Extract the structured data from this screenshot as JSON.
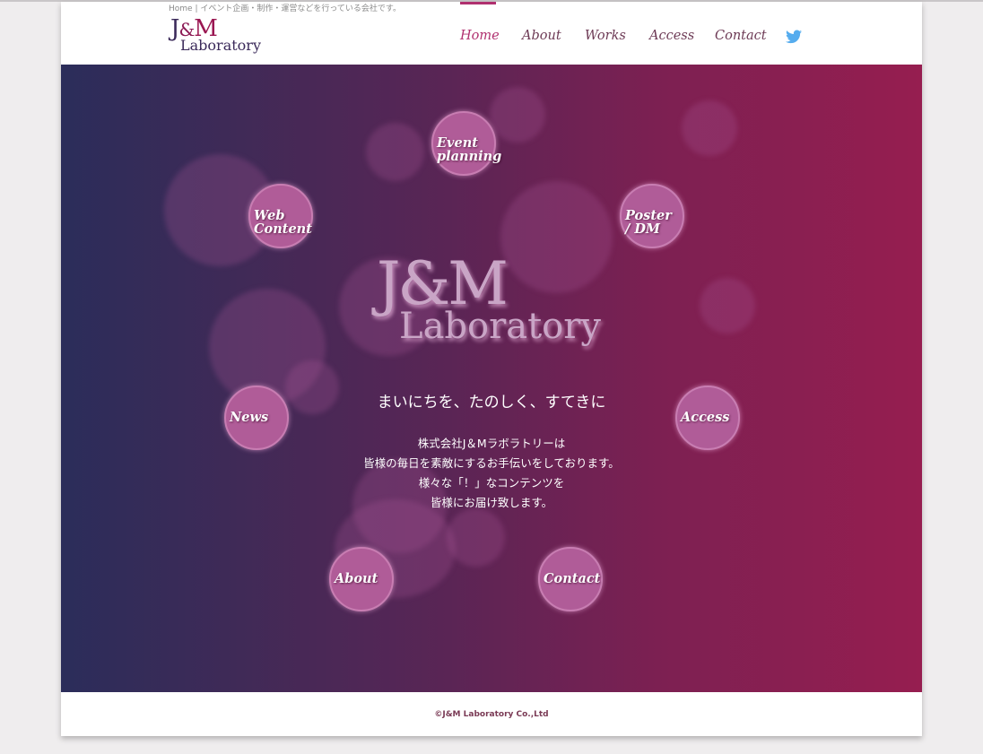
{
  "header": {
    "tagline": "Home | イベント企画・制作・運営などを行っている会社です。",
    "logo": {
      "line1_j": "J",
      "line1_amp": "&",
      "line1_m": "M",
      "line2": "Laboratory"
    },
    "nav": [
      {
        "label": "Home",
        "active": true
      },
      {
        "label": "About",
        "active": false
      },
      {
        "label": "Works",
        "active": false
      },
      {
        "label": "Access",
        "active": false
      },
      {
        "label": "Contact",
        "active": false
      }
    ],
    "twitter_icon": "twitter-bird-icon",
    "accent_color": "#b0306f"
  },
  "hero": {
    "big_logo_line1": "J&M",
    "big_logo_line2": "Laboratory",
    "catchphrase": "まいにちを、たのしく、すてきに",
    "description": [
      "株式会社J＆Mラボラトリーは",
      "皆様の毎日を素敵にするお手伝いをしております。",
      "様々な「！」なコンテンツを",
      "皆様にお届け致します。"
    ],
    "circles": {
      "event": "Event\nplanning",
      "web": "Web\nContent",
      "poster": "Poster\n/ DM",
      "news": "News",
      "access": "Access",
      "about": "About",
      "contact": "Contact"
    }
  },
  "footer": {
    "copyright": "©J&M Laboratory Co.,Ltd"
  }
}
